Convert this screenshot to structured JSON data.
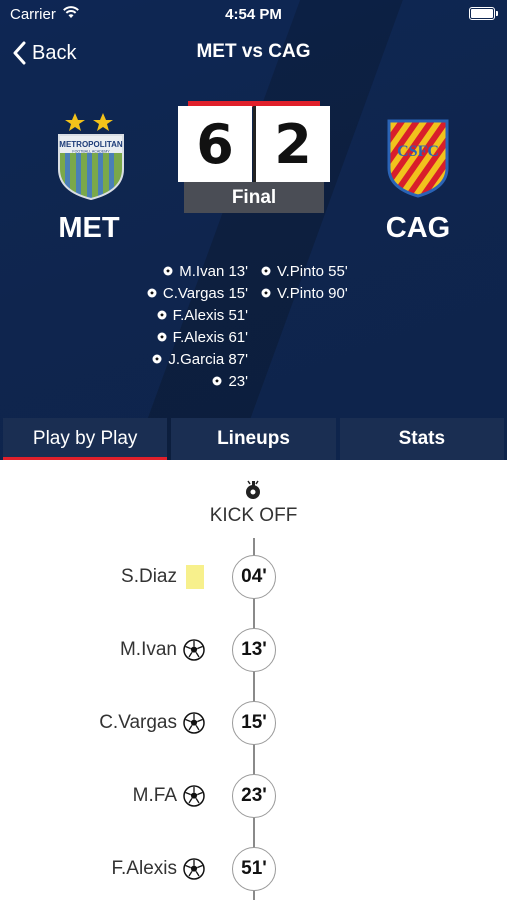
{
  "status_bar": {
    "carrier": "Carrier",
    "time": "4:54 PM"
  },
  "nav": {
    "back_label": "Back",
    "title": "MET vs CAG"
  },
  "match": {
    "home": {
      "abbr": "MET",
      "crest_text": "METROPOLITAN",
      "crest_subtext": "FOOTBALL ACADEMY",
      "score": "6"
    },
    "away": {
      "abbr": "CAG",
      "crest_text": "CSFC",
      "score": "2"
    },
    "status": "Final"
  },
  "home_scorers": [
    "M.Ivan 13'",
    "C.Vargas 15'",
    "F.Alexis 51'",
    "F.Alexis 61'",
    "J.Garcia 87'",
    "23'"
  ],
  "away_scorers": [
    "V.Pinto 55'",
    "V.Pinto 90'"
  ],
  "tabs": [
    {
      "label": "Play by Play",
      "active": true
    },
    {
      "label": "Lineups",
      "active": false
    },
    {
      "label": "Stats",
      "active": false
    }
  ],
  "timeline": {
    "kickoff_label": "KICK OFF",
    "events": [
      {
        "player": "S.Diaz",
        "type": "yellow-card",
        "minute": "04'"
      },
      {
        "player": "M.Ivan",
        "type": "goal",
        "minute": "13'"
      },
      {
        "player": "C.Vargas",
        "type": "goal",
        "minute": "15'"
      },
      {
        "player": "M.FA",
        "type": "goal",
        "minute": "23'"
      },
      {
        "player": "F.Alexis",
        "type": "goal",
        "minute": "51'"
      }
    ]
  },
  "colors": {
    "header_bg": "#0d1f3f",
    "tab_bg": "#1a2e52",
    "accent_red": "#e0202b",
    "final_badge": "#4a4d55",
    "yellow_card": "#f7f08c"
  }
}
